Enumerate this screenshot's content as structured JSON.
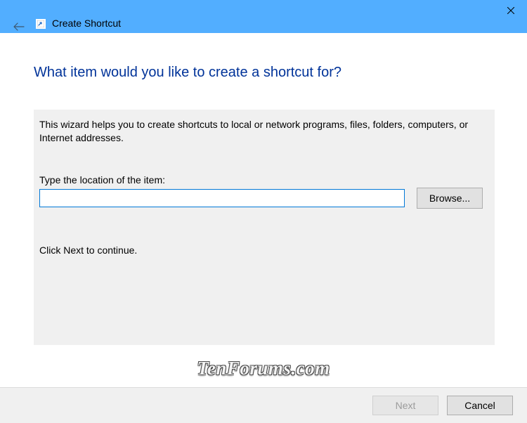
{
  "window": {
    "title": "Create Shortcut"
  },
  "heading": "What item would you like to create a shortcut for?",
  "description": "This wizard helps you to create shortcuts to local or network programs, files, folders, computers, or Internet addresses.",
  "location_label": "Type the location of the item:",
  "location_value": "",
  "browse_label": "Browse...",
  "continue_text": "Click Next to continue.",
  "footer": {
    "next_label": "Next",
    "cancel_label": "Cancel"
  },
  "watermark": "TenForums.com"
}
